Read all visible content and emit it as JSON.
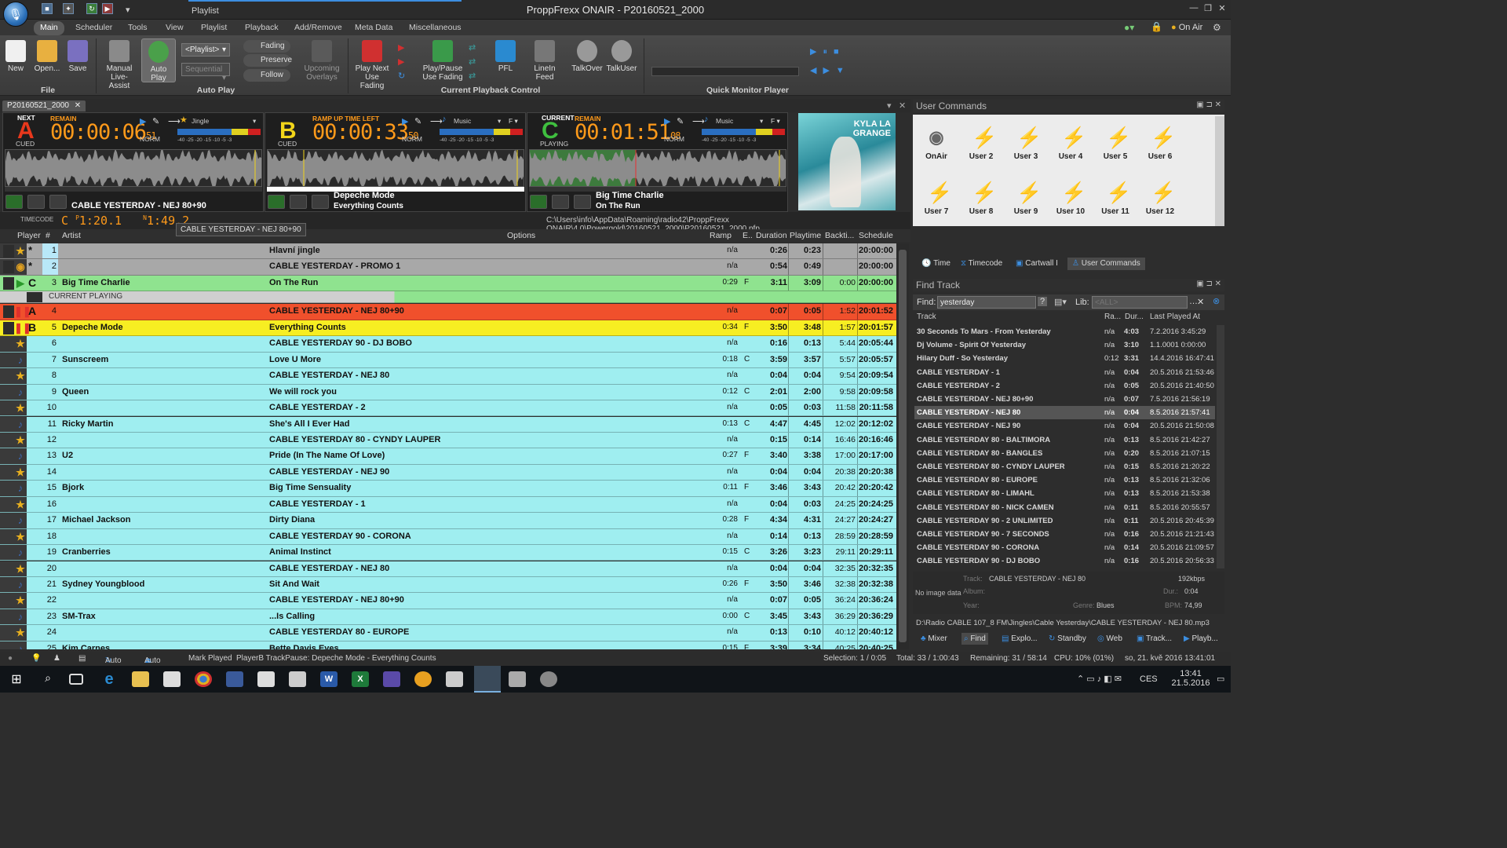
{
  "app": {
    "ctx_tab": "Playlist",
    "title": "ProppFrexx ONAIR",
    "document": "P20160521_2000",
    "onair_label": "On Air"
  },
  "ribbon": {
    "tabs": [
      "Main",
      "Scheduler",
      "Tools",
      "View",
      "Playlist",
      "Playback",
      "Add/Remove",
      "Meta Data",
      "Miscellaneous"
    ],
    "file": {
      "new": "New",
      "open": "Open...",
      "save": "Save",
      "group": "File"
    },
    "autoplay": {
      "manual": "Manual Live-Assist",
      "auto": "Auto Play",
      "playlist_combo": "<Playlist>",
      "sequential_combo": "Sequential",
      "fading": "Fading",
      "preserve": "Preserve",
      "follow": "Follow",
      "upcoming": "Upcoming Overlays",
      "group": "Auto Play"
    },
    "playback": {
      "play_next": "Play Next Use Fading",
      "play_pause": "Play/Pause Use Fading",
      "pfl": "PFL",
      "linein": "LineIn Feed",
      "group": "Current Playback Control"
    },
    "talk": {
      "talkover": "TalkOver",
      "talkuser": "TalkUser"
    },
    "monitor": {
      "group": "Quick Monitor Player"
    }
  },
  "doc_tab": "P20160521_2000",
  "decks": [
    {
      "top_label": "NEXT",
      "letter": "A",
      "state": "CUED",
      "remain_label": "REMAIN",
      "time": "00:00:06",
      "time_frac": "51",
      "mode": "NORM",
      "type": "Jingle",
      "title": "CABLE YESTERDAY - NEJ 80+90",
      "subtitle": "",
      "color": "#e8381c"
    },
    {
      "top_label": "",
      "letter": "B",
      "state": "CUED",
      "remain_label": "RAMP UP TIME LEFT",
      "time": "00:00:33",
      "time_frac": "50",
      "mode": "NORM",
      "type": "Music",
      "title": "Depeche Mode",
      "subtitle": "Everything Counts",
      "color": "#f2d51a"
    },
    {
      "top_label": "CURRENT",
      "letter": "C",
      "state": "PLAYING",
      "remain_label": "REMAIN",
      "time": "00:01:51",
      "time_frac": "08",
      "mode": "NORM",
      "type": "Music",
      "title": "Big Time Charlie",
      "subtitle": "On The Run",
      "color": "#3fbf3f"
    }
  ],
  "meter_scale": "-40 -25 -20 -15 -10 -5 -3",
  "album_art_text": "KYLA LA GRANGE",
  "info": {
    "timecode_label": "TIMECODE",
    "c_time": "1:20.1",
    "n_time": "1:49.2",
    "tooltip": "CABLE YESTERDAY - NEJ 80+90",
    "path": "C:\\Users\\info\\AppData\\Roaming\\radio42\\ProppFrexx ONAIR\\4.0\\Powergold\\20160521_2000\\P20160521_2000.pfp"
  },
  "playlist": {
    "columns": {
      "player": "Player",
      "num": "#",
      "artist": "Artist",
      "options": "Options",
      "ramp": "Ramp",
      "e": "E..",
      "duration": "Duration",
      "playtime": "Playtime",
      "backtime": "Backti...",
      "schedule": "Schedule"
    },
    "current_label": "CURRENT  PLAYING",
    "rows": [
      {
        "n": "1",
        "lead": "*",
        "icon": "star",
        "artist": "",
        "title": "Hlavní jingle",
        "ramp": "n/a",
        "e": "",
        "dur": "0:26",
        "play": "0:23",
        "back": "",
        "sched": "20:00:00",
        "bg": "#a8a8a8"
      },
      {
        "n": "2",
        "lead": "*",
        "icon": "globe",
        "artist": "",
        "title": "CABLE YESTERDAY - PROMO 1",
        "ramp": "n/a",
        "e": "",
        "dur": "0:54",
        "play": "0:49",
        "back": "",
        "sched": "20:00:00",
        "bg": "#a8a8a8"
      },
      {
        "n": "3",
        "lead": "C",
        "icon": "play",
        "artist": "Big Time Charlie",
        "title": "On The Run",
        "ramp": "0:29",
        "e": "F",
        "dur": "3:11",
        "play": "3:09",
        "back": "0:00",
        "sched": "20:00:00",
        "bg": "#8fe38f"
      },
      {
        "n": "4",
        "lead": "A",
        "icon": "pause",
        "artist": "",
        "title": "CABLE YESTERDAY - NEJ 80+90",
        "ramp": "n/a",
        "e": "",
        "dur": "0:07",
        "play": "0:05",
        "back": "1:52",
        "sched": "20:01:52",
        "bg": "#f0502c"
      },
      {
        "n": "5",
        "lead": "B",
        "icon": "pause",
        "artist": "Depeche Mode",
        "title": "Everything Counts",
        "ramp": "0:34",
        "e": "F",
        "dur": "3:50",
        "play": "3:48",
        "back": "1:57",
        "sched": "20:01:57",
        "bg": "#f7ee22"
      },
      {
        "n": "6",
        "lead": "",
        "icon": "star",
        "artist": "",
        "title": "CABLE YESTERDAY 90 - DJ BOBO",
        "ramp": "n/a",
        "e": "",
        "dur": "0:16",
        "play": "0:13",
        "back": "5:44",
        "sched": "20:05:44",
        "bg": "#9feef0"
      },
      {
        "n": "7",
        "lead": "",
        "icon": "note",
        "artist": "Sunscreem",
        "title": "Love U More",
        "ramp": "0:18",
        "e": "C",
        "dur": "3:59",
        "play": "3:57",
        "back": "5:57",
        "sched": "20:05:57",
        "bg": "#9feef0"
      },
      {
        "n": "8",
        "lead": "",
        "icon": "star",
        "artist": "",
        "title": "CABLE YESTERDAY - NEJ 80",
        "ramp": "n/a",
        "e": "",
        "dur": "0:04",
        "play": "0:04",
        "back": "9:54",
        "sched": "20:09:54",
        "bg": "#9feef0"
      },
      {
        "n": "9",
        "lead": "",
        "icon": "note",
        "artist": "Queen",
        "title": "We will rock you",
        "ramp": "0:12",
        "e": "C",
        "dur": "2:01",
        "play": "2:00",
        "back": "9:58",
        "sched": "20:09:58",
        "bg": "#9feef0"
      },
      {
        "n": "10",
        "lead": "",
        "icon": "star",
        "artist": "",
        "title": "CABLE YESTERDAY - 2",
        "ramp": "n/a",
        "e": "",
        "dur": "0:05",
        "play": "0:03",
        "back": "11:58",
        "sched": "20:11:58",
        "bg": "#9feef0"
      },
      {
        "n": "11",
        "lead": "",
        "icon": "note",
        "artist": "Ricky Martin",
        "title": "She's All I Ever Had",
        "ramp": "0:13",
        "e": "C",
        "dur": "4:47",
        "play": "4:45",
        "back": "12:02",
        "sched": "20:12:02",
        "bg": "#9feef0"
      },
      {
        "n": "12",
        "lead": "",
        "icon": "star",
        "artist": "",
        "title": "CABLE YESTERDAY 80 - CYNDY LAUPER",
        "ramp": "n/a",
        "e": "",
        "dur": "0:15",
        "play": "0:14",
        "back": "16:46",
        "sched": "20:16:46",
        "bg": "#9feef0"
      },
      {
        "n": "13",
        "lead": "",
        "icon": "note",
        "artist": "U2",
        "title": "Pride (In The Name Of Love)",
        "ramp": "0:27",
        "e": "F",
        "dur": "3:40",
        "play": "3:38",
        "back": "17:00",
        "sched": "20:17:00",
        "bg": "#9feef0"
      },
      {
        "n": "14",
        "lead": "",
        "icon": "star",
        "artist": "",
        "title": "CABLE YESTERDAY - NEJ 90",
        "ramp": "n/a",
        "e": "",
        "dur": "0:04",
        "play": "0:04",
        "back": "20:38",
        "sched": "20:20:38",
        "bg": "#9feef0"
      },
      {
        "n": "15",
        "lead": "",
        "icon": "note",
        "artist": "Bjork",
        "title": "Big Time Sensuality",
        "ramp": "0:11",
        "e": "F",
        "dur": "3:46",
        "play": "3:43",
        "back": "20:42",
        "sched": "20:20:42",
        "bg": "#9feef0"
      },
      {
        "n": "16",
        "lead": "",
        "icon": "star",
        "artist": "",
        "title": "CABLE YESTERDAY - 1",
        "ramp": "n/a",
        "e": "",
        "dur": "0:04",
        "play": "0:03",
        "back": "24:25",
        "sched": "20:24:25",
        "bg": "#9feef0"
      },
      {
        "n": "17",
        "lead": "",
        "icon": "note",
        "artist": "Michael Jackson",
        "title": "Dirty Diana",
        "ramp": "0:28",
        "e": "F",
        "dur": "4:34",
        "play": "4:31",
        "back": "24:27",
        "sched": "20:24:27",
        "bg": "#9feef0"
      },
      {
        "n": "18",
        "lead": "",
        "icon": "star",
        "artist": "",
        "title": "CABLE YESTERDAY 90 - CORONA",
        "ramp": "n/a",
        "e": "",
        "dur": "0:14",
        "play": "0:13",
        "back": "28:59",
        "sched": "20:28:59",
        "bg": "#9feef0"
      },
      {
        "n": "19",
        "lead": "",
        "icon": "note",
        "artist": "Cranberries",
        "title": "Animal Instinct",
        "ramp": "0:15",
        "e": "C",
        "dur": "3:26",
        "play": "3:23",
        "back": "29:11",
        "sched": "20:29:11",
        "bg": "#9feef0"
      },
      {
        "n": "20",
        "lead": "",
        "icon": "star",
        "artist": "",
        "title": "CABLE YESTERDAY - NEJ 80",
        "ramp": "n/a",
        "e": "",
        "dur": "0:04",
        "play": "0:04",
        "back": "32:35",
        "sched": "20:32:35",
        "bg": "#9feef0"
      },
      {
        "n": "21",
        "lead": "",
        "icon": "note",
        "artist": "Sydney Youngblood",
        "title": "Sit And Wait",
        "ramp": "0:26",
        "e": "F",
        "dur": "3:50",
        "play": "3:46",
        "back": "32:38",
        "sched": "20:32:38",
        "bg": "#9feef0"
      },
      {
        "n": "22",
        "lead": "",
        "icon": "star",
        "artist": "",
        "title": "CABLE YESTERDAY - NEJ 80+90",
        "ramp": "n/a",
        "e": "",
        "dur": "0:07",
        "play": "0:05",
        "back": "36:24",
        "sched": "20:36:24",
        "bg": "#9feef0"
      },
      {
        "n": "23",
        "lead": "",
        "icon": "note",
        "artist": "SM-Trax",
        "title": "...Is Calling",
        "ramp": "0:00",
        "e": "C",
        "dur": "3:45",
        "play": "3:43",
        "back": "36:29",
        "sched": "20:36:29",
        "bg": "#9feef0"
      },
      {
        "n": "24",
        "lead": "",
        "icon": "star",
        "artist": "",
        "title": "CABLE YESTERDAY 80 - EUROPE",
        "ramp": "n/a",
        "e": "",
        "dur": "0:13",
        "play": "0:10",
        "back": "40:12",
        "sched": "20:40:12",
        "bg": "#9feef0"
      },
      {
        "n": "25",
        "lead": "",
        "icon": "note",
        "artist": "Kim Carnes",
        "title": "Bette Davis Eyes",
        "ramp": "0:15",
        "e": "F",
        "dur": "3:39",
        "play": "3:34",
        "back": "40:25",
        "sched": "20:40:25",
        "bg": "#9feef0"
      }
    ]
  },
  "user_commands": {
    "title": "User Commands",
    "buttons": [
      "OnAir",
      "User 2",
      "User 3",
      "User 4",
      "User 5",
      "User 6",
      "User 7",
      "User 8",
      "User 9",
      "User 10",
      "User 11",
      "User 12"
    ],
    "tabs": [
      "Time",
      "Timecode",
      "Cartwall I",
      "User Commands"
    ]
  },
  "find_track": {
    "title": "Find Track",
    "find_label": "Find:",
    "find_value": "yesterday",
    "lib_label": "Lib:",
    "lib_placeholder": "<ALL>",
    "columns": {
      "track": "Track",
      "ra": "Ra...",
      "dur": "Dur...",
      "last": "Last Played At"
    },
    "rows": [
      {
        "track": "30 Seconds To Mars - From Yesterday",
        "ra": "n/a",
        "dur": "4:03",
        "last": "7.2.2016 3:45:29"
      },
      {
        "track": "Dj Volume - Spirit Of Yesterday",
        "ra": "n/a",
        "dur": "3:10",
        "last": "1.1.0001 0:00:00"
      },
      {
        "track": "Hilary Duff - So Yesterday",
        "ra": "0:12",
        "dur": "3:31",
        "last": "14.4.2016 16:47:41"
      },
      {
        "track": "CABLE YESTERDAY - 1",
        "ra": "n/a",
        "dur": "0:04",
        "last": "20.5.2016 21:53:46"
      },
      {
        "track": "CABLE YESTERDAY - 2",
        "ra": "n/a",
        "dur": "0:05",
        "last": "20.5.2016 21:40:50"
      },
      {
        "track": "CABLE YESTERDAY - NEJ 80+90",
        "ra": "n/a",
        "dur": "0:07",
        "last": "7.5.2016 21:56:19"
      },
      {
        "track": "CABLE YESTERDAY - NEJ 80",
        "ra": "n/a",
        "dur": "0:04",
        "last": "8.5.2016 21:57:41"
      },
      {
        "track": "CABLE YESTERDAY - NEJ 90",
        "ra": "n/a",
        "dur": "0:04",
        "last": "20.5.2016 21:50:08"
      },
      {
        "track": "CABLE YESTERDAY 80 - BALTIMORA",
        "ra": "n/a",
        "dur": "0:13",
        "last": "8.5.2016 21:42:27"
      },
      {
        "track": "CABLE YESTERDAY 80 - BANGLES",
        "ra": "n/a",
        "dur": "0:20",
        "last": "8.5.2016 21:07:15"
      },
      {
        "track": "CABLE YESTERDAY 80 - CYNDY LAUPER",
        "ra": "n/a",
        "dur": "0:15",
        "last": "8.5.2016 21:20:22"
      },
      {
        "track": "CABLE YESTERDAY 80 - EUROPE",
        "ra": "n/a",
        "dur": "0:13",
        "last": "8.5.2016 21:32:06"
      },
      {
        "track": "CABLE YESTERDAY 80 - LIMAHL",
        "ra": "n/a",
        "dur": "0:13",
        "last": "8.5.2016 21:53:38"
      },
      {
        "track": "CABLE YESTERDAY 80 - NICK CAMEN",
        "ra": "n/a",
        "dur": "0:11",
        "last": "8.5.2016 20:55:57"
      },
      {
        "track": "CABLE YESTERDAY 90 - 2 UNLIMITED",
        "ra": "n/a",
        "dur": "0:11",
        "last": "20.5.2016 20:45:39"
      },
      {
        "track": "CABLE YESTERDAY 90 - 7 SECONDS",
        "ra": "n/a",
        "dur": "0:16",
        "last": "20.5.2016 21:21:43"
      },
      {
        "track": "CABLE YESTERDAY 90 - CORONA",
        "ra": "n/a",
        "dur": "0:14",
        "last": "20.5.2016 21:09:57"
      },
      {
        "track": "CABLE YESTERDAY 90 - DJ BOBO",
        "ra": "n/a",
        "dur": "0:16",
        "last": "20.5.2016 20:56:33"
      }
    ],
    "detail": {
      "no_image": "No image data",
      "track_label": "Track:",
      "track": "CABLE YESTERDAY - NEJ 80",
      "bitrate": "192kbps",
      "album_label": "Album:",
      "dur_label": "Dur.:",
      "dur": "0:04",
      "year_label": "Year:",
      "genre_label": "Genre:",
      "genre": "Blues",
      "bpm_label": "BPM:",
      "bpm": "74,99"
    },
    "path": "D:\\Radio CABLE 107_8 FM\\Jingles\\Cable Yesterday\\CABLE YESTERDAY - NEJ 80.mp3"
  },
  "bottom_tabs": [
    "Mixer",
    "Find",
    "Explo...",
    "Standby",
    "Web",
    "Track...",
    "Playb..."
  ],
  "status": {
    "auto1": "Auto",
    "auto2": "Auto",
    "mark": "Mark Played",
    "msg": "PlayerB TrackPause: Depeche Mode - Everything Counts",
    "selection": "Selection: 1 / 0:05",
    "total": "Total: 33 / 1:00:43",
    "remaining": "Remaining: 31 / 58:14",
    "cpu": "CPU: 10% (01%)",
    "datetime": "so, 21. kvě 2016 13:41:01"
  },
  "taskbar": {
    "lang": "CES",
    "time": "13:41",
    "date": "21.5.2016"
  },
  "colors": {
    "accent": "#3c8ee0",
    "orange": "#ff9a1a",
    "current": "#8fe38f",
    "cyan": "#9feef0"
  }
}
